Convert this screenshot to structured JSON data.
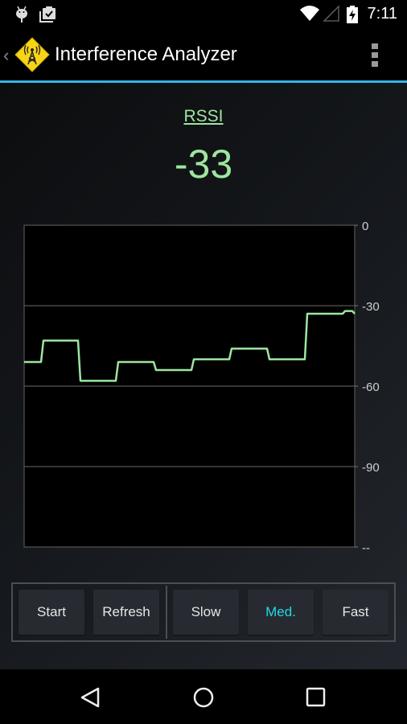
{
  "statusbar": {
    "time": "7:11",
    "icons": [
      "android-debug-icon",
      "clipboard-check-icon",
      "wifi-icon",
      "cell-signal-icon",
      "battery-charging-icon"
    ]
  },
  "actionbar": {
    "title": "Interference Analyzer",
    "back_glyph": "‹",
    "logo_icon": "radio-tower-warning-icon",
    "menu_icon": "overflow-menu-icon"
  },
  "colors": {
    "accent": "#33b5e5",
    "trace": "#9ee6a0",
    "active_button": "#21d8e8"
  },
  "reading": {
    "label": "RSSI",
    "value": "-33"
  },
  "chart_data": {
    "type": "line",
    "title": "",
    "xlabel": "",
    "ylabel": "",
    "ylim": [
      -120,
      0
    ],
    "grid": true,
    "y_ticks": [
      0,
      -30,
      -60,
      -90,
      -120
    ],
    "y_tick_labels": [
      "0",
      "-30",
      "-60",
      "-90",
      "--"
    ],
    "step": true,
    "series": [
      {
        "name": "RSSI",
        "x": [
          0,
          1,
          2,
          3,
          4,
          5,
          6,
          7,
          8,
          9
        ],
        "values": [
          -51,
          -43,
          -58,
          -51,
          -54,
          -50,
          -46,
          -50,
          -33,
          -32
        ]
      }
    ],
    "last_value": -33
  },
  "controls": {
    "buttons": [
      {
        "label": "Start",
        "active": false
      },
      {
        "label": "Refresh",
        "active": false
      },
      {
        "label": "Slow",
        "active": false
      },
      {
        "label": "Med.",
        "active": true
      },
      {
        "label": "Fast",
        "active": false
      }
    ]
  },
  "navbar": {
    "buttons": [
      "back-icon",
      "home-icon",
      "recents-icon"
    ]
  }
}
